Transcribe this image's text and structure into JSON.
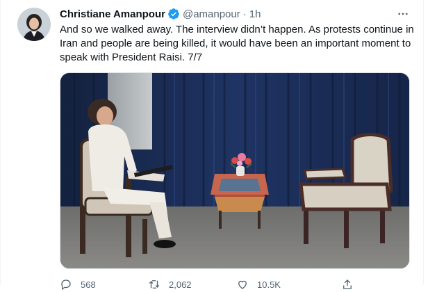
{
  "tweet": {
    "author_name": "Christiane Amanpour",
    "handle": "@amanpour",
    "separator": "·",
    "time": "1h",
    "text": "And so we walked away. The interview didn’t happen. As protests continue in Iran and people are being killed, it would have been an important moment to speak with President Raisi. 7/7"
  },
  "actions": {
    "reply_count": "568",
    "retweet_count": "2,062",
    "like_count": "10.5K"
  },
  "icons": {
    "verified": "verified-badge-icon",
    "more": "more-options-icon",
    "reply": "reply-icon",
    "retweet": "retweet-icon",
    "like": "heart-icon",
    "share": "share-icon"
  },
  "colors": {
    "accent": "#1d9bf0",
    "text": "#0f1419",
    "secondary": "#536471"
  }
}
